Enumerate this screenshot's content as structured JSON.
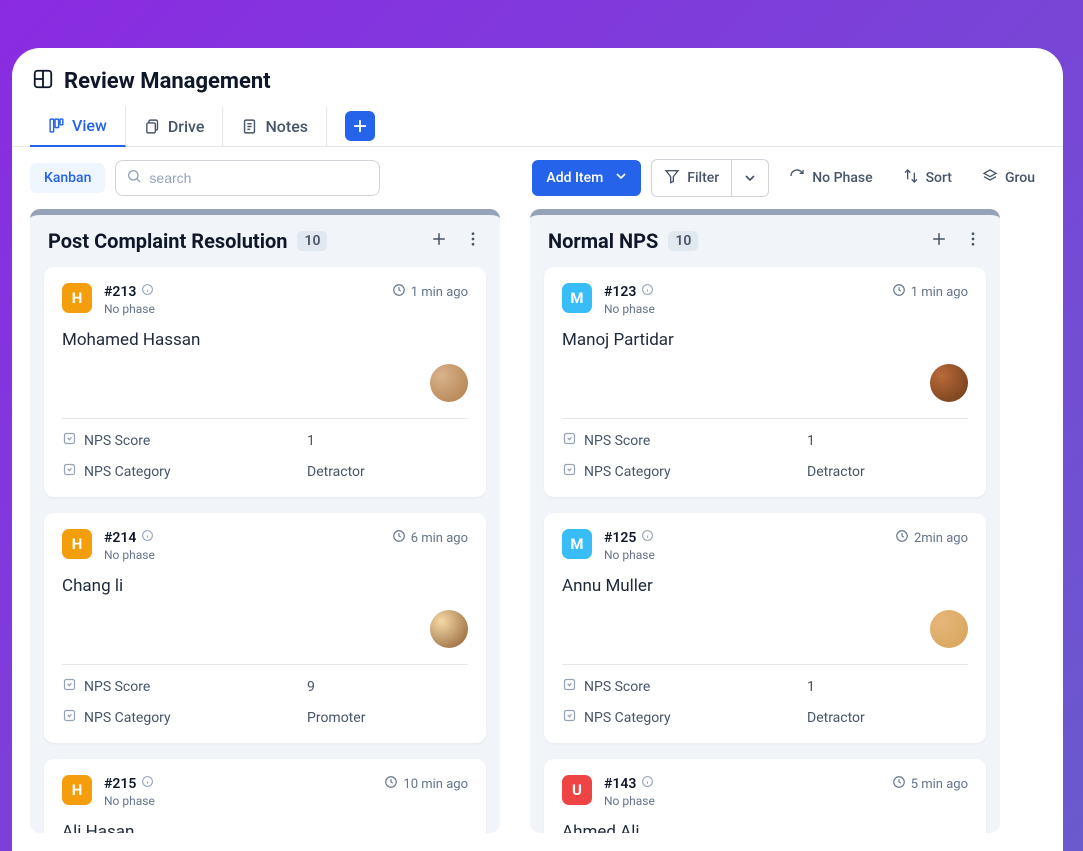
{
  "page_title": "Review Management",
  "tabs": {
    "view": "View",
    "drive": "Drive",
    "notes": "Notes"
  },
  "toolbar": {
    "kanban": "Kanban",
    "search_placeholder": "search",
    "add_item": "Add Item",
    "filter": "Filter",
    "no_phase": "No Phase",
    "sort": "Sort",
    "group": "Grou"
  },
  "field_labels": {
    "nps_score": "NPS Score",
    "nps_category": "NPS Category"
  },
  "columns": [
    {
      "title": "Post Complaint Resolution",
      "count": "10",
      "cards": [
        {
          "avatar_letter": "H",
          "avatar_color": "orange",
          "id": "#213",
          "phase": "No phase",
          "time": "1 min ago",
          "name": "Mohamed Hassan",
          "assignee_class": "ac1",
          "nps_score": "1",
          "nps_category": "Detractor"
        },
        {
          "avatar_letter": "H",
          "avatar_color": "orange",
          "id": "#214",
          "phase": "No phase",
          "time": "6 min ago",
          "name": "Chang li",
          "assignee_class": "ac2",
          "nps_score": "9",
          "nps_category": "Promoter"
        },
        {
          "avatar_letter": "H",
          "avatar_color": "orange",
          "id": "#215",
          "phase": "No phase",
          "time": "10 min ago",
          "name": "Ali Hasan",
          "nps_score": "",
          "nps_category": ""
        }
      ]
    },
    {
      "title": "Normal NPS",
      "count": "10",
      "cards": [
        {
          "avatar_letter": "M",
          "avatar_color": "blue",
          "id": "#123",
          "phase": "No phase",
          "time": "1 min ago",
          "name": "Manoj Partidar",
          "assignee_class": "ac3",
          "nps_score": "1",
          "nps_category": "Detractor"
        },
        {
          "avatar_letter": "M",
          "avatar_color": "blue",
          "id": "#125",
          "phase": "No phase",
          "time": "2min ago",
          "name": "Annu Muller",
          "assignee_class": "ac4",
          "nps_score": "1",
          "nps_category": "Detractor"
        },
        {
          "avatar_letter": "U",
          "avatar_color": "red",
          "id": "#143",
          "phase": "No phase",
          "time": "5 min ago",
          "name": "Ahmed Ali",
          "nps_score": "",
          "nps_category": ""
        }
      ]
    }
  ]
}
